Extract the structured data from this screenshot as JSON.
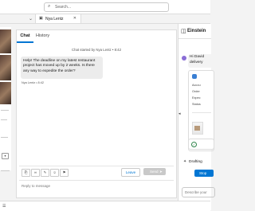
{
  "header": {
    "search_placeholder": "Search...",
    "search_icon": "search-icon"
  },
  "tabs": {
    "overflow_icon": "chevron-down-icon",
    "active_label": "Nya Lentz",
    "active_icon": "chat-icon",
    "close_icon": "close-icon"
  },
  "chat": {
    "tabs": [
      "Chat",
      "History"
    ],
    "started_text": "Chat started by Nya Lentz • 8:42",
    "message_text": "Help! The deadline on my latest restaurant project has moved up by 2 weeks. Is there any way to expedite the order?",
    "message_meta": "Nya Lentz • 8:42",
    "toolbar_icons": [
      "attach-icon",
      "link-icon",
      "quick-text-icon",
      "emoji-icon",
      "flag-icon"
    ],
    "leave_label": "Leave",
    "send_label": "Send",
    "reply_placeholder": "Reply to message"
  },
  "einstein": {
    "title": "Einstein",
    "greeting": "Hi David",
    "greeting_2": "delivery",
    "card_rows": [
      "Accou",
      "Order",
      "Expec",
      "Status"
    ],
    "drafting": "Drafting",
    "stop_label": "Stop",
    "input_placeholder": "Describe your"
  },
  "colors": {
    "accent": "#0176d3",
    "send_disabled": "#c9c9c9"
  }
}
